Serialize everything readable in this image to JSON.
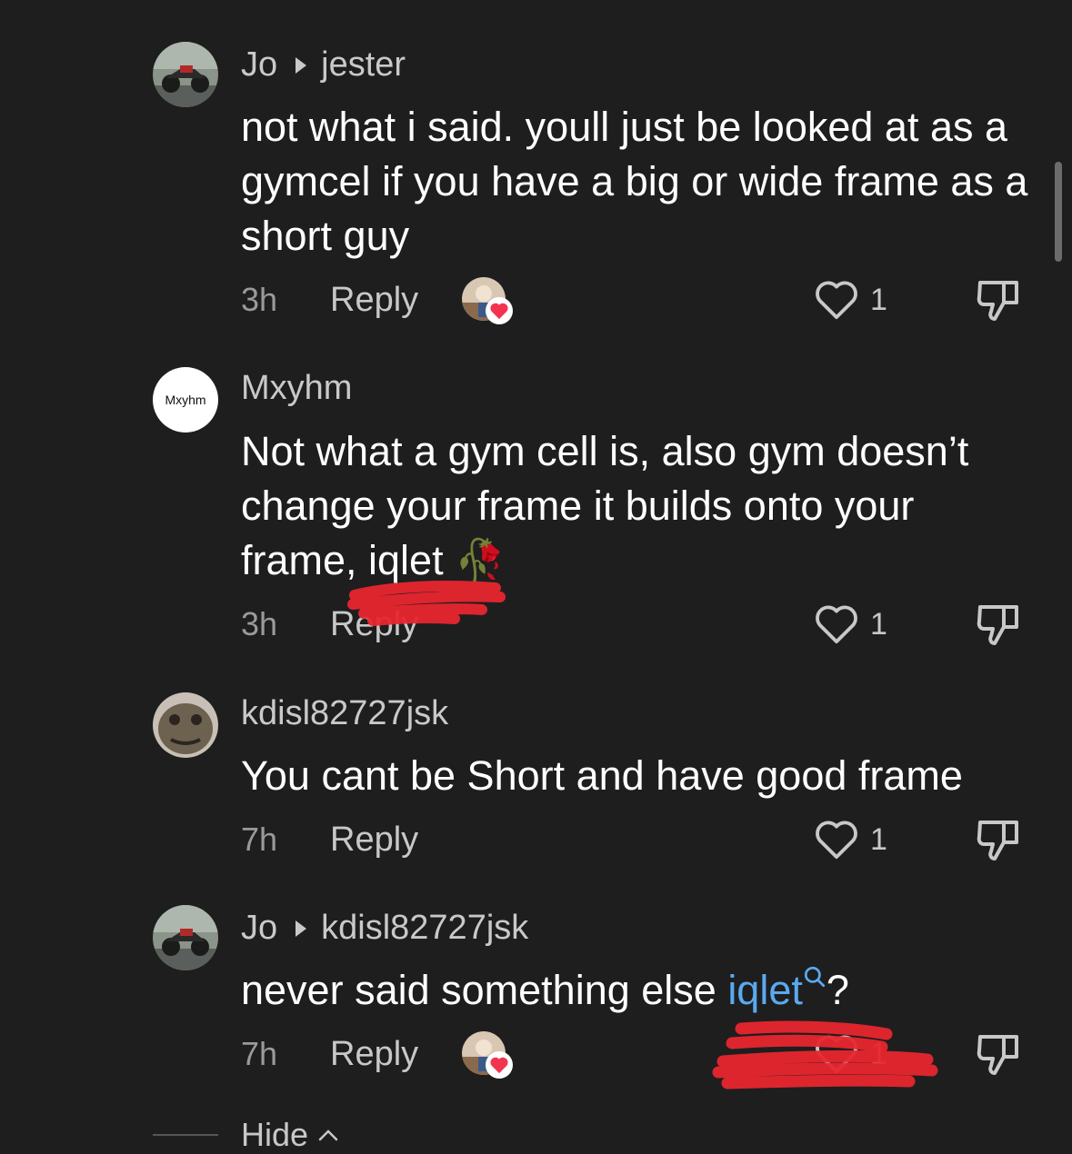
{
  "comments": [
    {
      "author": "Jo",
      "reply_to": "jester",
      "text": "not what i said. youll just be looked at as a gymcel if you have a big or wide frame as a short guy",
      "time": "3h",
      "reply_label": "Reply",
      "likes": "1",
      "liked_by_creator": true
    },
    {
      "author": "Mxyhm",
      "avatar_text": "Mxyhm",
      "text": "Not what a gym cell is, also gym doesn’t change your frame it builds onto your frame, iqlet",
      "emoji": "🥀",
      "time": "3h",
      "reply_label": "Reply",
      "likes": "1"
    },
    {
      "author": "kdisl82727jsk",
      "text": "You cant be Short and have good frame",
      "time": "7h",
      "reply_label": "Reply",
      "likes": "1"
    },
    {
      "author": "Jo",
      "reply_to": "kdisl82727jsk",
      "text_before": "never said something else ",
      "mention": "iqlet",
      "text_after": "?",
      "time": "7h",
      "reply_label": "Reply",
      "likes": "1",
      "liked_by_creator": true
    }
  ],
  "footer": {
    "hide_label": "Hide"
  },
  "colors": {
    "background": "#1e1e1e",
    "mention": "#5aa9f0",
    "scribble": "#e8262f",
    "heart_badge": "#f2344f"
  },
  "icons": [
    "heart-outline-icon",
    "dislike-icon",
    "chevron-up-icon",
    "search-icon",
    "reply-arrow-icon"
  ]
}
